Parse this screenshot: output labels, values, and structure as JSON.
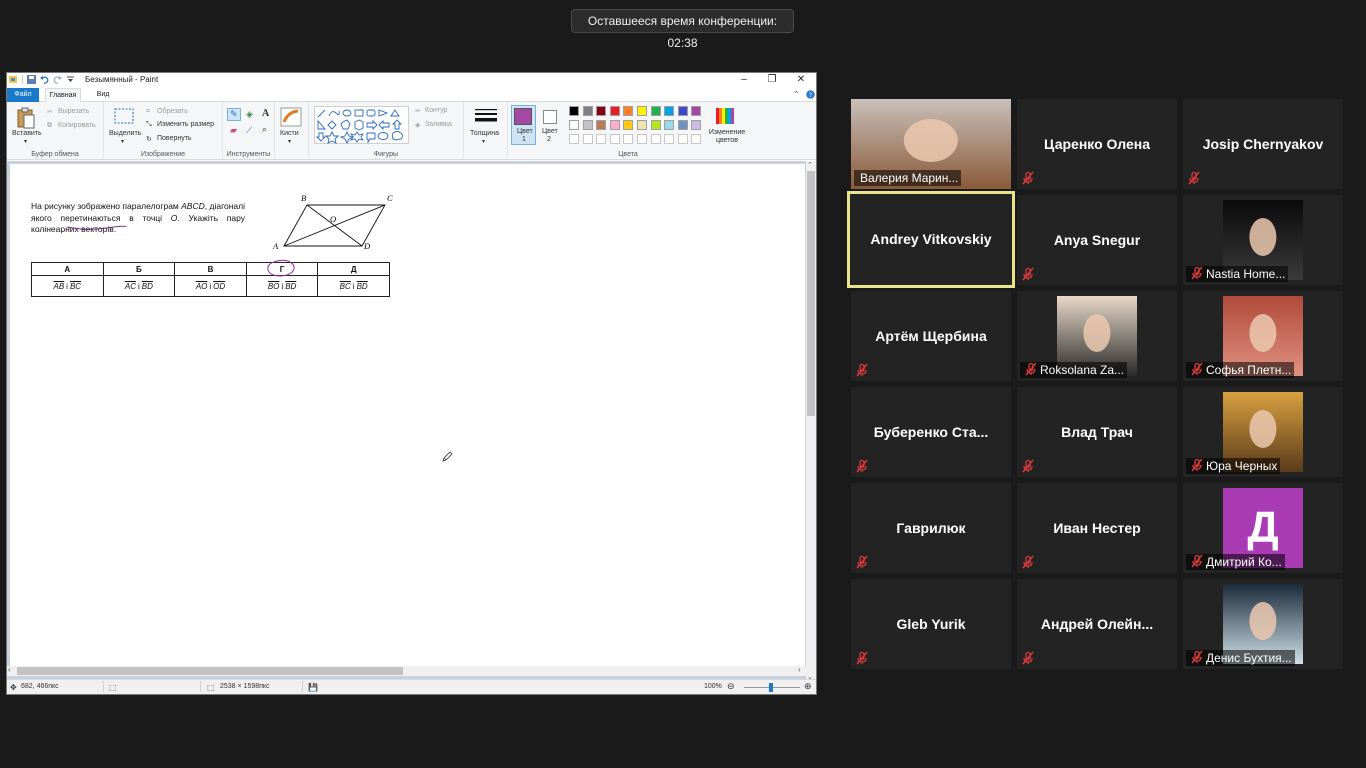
{
  "conference": {
    "timer_text": "Оставшееся время конференции: 02:38"
  },
  "paint": {
    "title": "Безымянный - Paint",
    "tabs": {
      "file": "Файл",
      "home": "Главная",
      "view": "Вид"
    },
    "ribbon": {
      "clipboard": {
        "paste": "Вставить",
        "cut": "Вырезать",
        "copy": "Копировать",
        "label": "Буфер обмена"
      },
      "image": {
        "select": "Выделить",
        "crop": "Обрезать",
        "resize": "Изменить размер",
        "rotate": "Повернуть",
        "label": "Изображение"
      },
      "tools": {
        "label": "Инструменты"
      },
      "brushes": {
        "label": "Кисти"
      },
      "shapes": {
        "outline": "Контур",
        "fill": "Заливка",
        "label": "Фигуры"
      },
      "size": {
        "label": "Толщина"
      },
      "colors": {
        "color1": "Цвет 1",
        "color2": "Цвет 2",
        "edit": "Изменение цветов",
        "label": "Цвета",
        "color1_value": "#a349a4",
        "color2_value": "#ffffff",
        "palette_row1": [
          "#000000",
          "#7f7f7f",
          "#880015",
          "#ed1c24",
          "#ff7f27",
          "#fff200",
          "#22b14c",
          "#00a2e8",
          "#3f48cc",
          "#a349a4"
        ],
        "palette_row2": [
          "#ffffff",
          "#c3c3c3",
          "#b97a57",
          "#ffaec9",
          "#ffc90e",
          "#efe4b0",
          "#b5e61d",
          "#99d9ea",
          "#7092be",
          "#c8bfe7"
        ]
      }
    },
    "canvas": {
      "problem_text_1": "На рисунку зображено паралелограм ",
      "problem_italic_1": "ABCD",
      "problem_text_2": ", діагоналі якого перетинаються в точці ",
      "problem_italic_2": "O",
      "problem_text_3": ". Укажіть пару колінеарних векторів.",
      "figure_labels": {
        "a": "A",
        "b": "B",
        "c": "C",
        "d": "D",
        "o": "O"
      },
      "table_headers": [
        "А",
        "Б",
        "В",
        "Г",
        "Д"
      ],
      "table_values": [
        {
          "v1": "AB",
          "v2": "BC"
        },
        {
          "v1": "AC",
          "v2": "BD"
        },
        {
          "v1": "AO",
          "v2": "OD"
        },
        {
          "v1": "BO",
          "v2": "BD"
        },
        {
          "v1": "BC",
          "v2": "BD"
        }
      ],
      "connector": "і"
    },
    "status": {
      "cursor_pos": "682, 466пкс",
      "image_size": "2538 × 1598пкс",
      "zoom": "100%"
    }
  },
  "participants": [
    {
      "name": "Валерия Марин...",
      "has_video": true,
      "muted": false
    },
    {
      "name": "Царенко Олена",
      "has_video": false,
      "muted": true
    },
    {
      "name": "Josip Chernyakov",
      "has_video": false,
      "muted": true
    },
    {
      "name": "Andrey Vitkovskiy",
      "has_video": false,
      "muted": false,
      "active": true
    },
    {
      "name": "Anya Snegur",
      "has_video": false,
      "muted": true
    },
    {
      "name": "Nastia Home...",
      "has_video": true,
      "muted": true
    },
    {
      "name": "Артём Щербина",
      "has_video": false,
      "muted": true
    },
    {
      "name": "Roksolana Za...",
      "has_video": true,
      "muted": true
    },
    {
      "name": "Софья Плетн...",
      "has_video": true,
      "muted": true
    },
    {
      "name": "Буберенко  Ста...",
      "has_video": false,
      "muted": true
    },
    {
      "name": "Влад Трач",
      "has_video": false,
      "muted": true
    },
    {
      "name": "Юра Черных",
      "has_video": true,
      "muted": true
    },
    {
      "name": "Гаврилюк",
      "has_video": false,
      "muted": true
    },
    {
      "name": "Иван Нестер",
      "has_video": false,
      "muted": true
    },
    {
      "name": "Дмитрий Ко...",
      "has_video": true,
      "muted": true,
      "avatar_letter": "Д"
    },
    {
      "name": "Gleb Yurik",
      "has_video": false,
      "muted": true
    },
    {
      "name": "Андрей  Олейн...",
      "has_video": false,
      "muted": true
    },
    {
      "name": "Денис Бухтия...",
      "has_video": true,
      "muted": true
    }
  ]
}
